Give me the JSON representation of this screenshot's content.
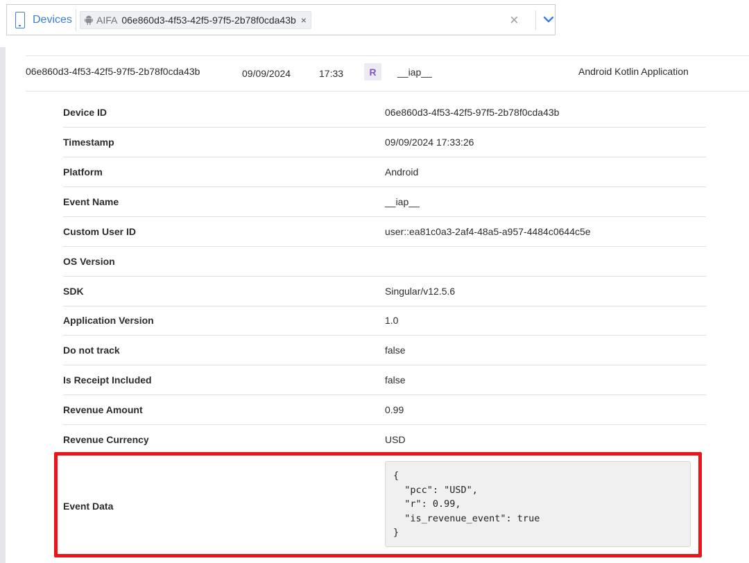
{
  "filter_bar": {
    "label": "Devices",
    "chip": {
      "type": "AIFA",
      "value": "06e860d3-4f53-42f5-97f5-2b78f0cda43b",
      "remove": "×"
    },
    "clear": "×"
  },
  "summary_row": {
    "device_id": "06e860d3-4f53-42f5-97f5-2b78f0cda43b",
    "date": "09/09/2024",
    "time": "17:33",
    "badge": "R",
    "event": "__iap__",
    "app": "Android Kotlin Application"
  },
  "details": [
    {
      "key": "Device ID",
      "value": "06e860d3-4f53-42f5-97f5-2b78f0cda43b"
    },
    {
      "key": "Timestamp",
      "value": "09/09/2024 17:33:26"
    },
    {
      "key": "Platform",
      "value": "Android"
    },
    {
      "key": "Event Name",
      "value": "__iap__"
    },
    {
      "key": "Custom User ID",
      "value": "user::ea81c0a3-2af4-48a5-a957-4484c0644c5e"
    },
    {
      "key": "OS Version",
      "value": ""
    },
    {
      "key": "SDK",
      "value": "Singular/v12.5.6"
    },
    {
      "key": "Application Version",
      "value": "1.0"
    },
    {
      "key": "Do not track",
      "value": "false"
    },
    {
      "key": "Is Receipt Included",
      "value": "false"
    },
    {
      "key": "Revenue Amount",
      "value": "0.99"
    },
    {
      "key": "Revenue Currency",
      "value": "USD"
    }
  ],
  "event_data": {
    "key": "Event Data",
    "json_text": "{\n  \"pcc\": \"USD\",\n  \"r\": 0.99,\n  \"is_revenue_event\": true\n}"
  },
  "colors": {
    "accent": "#3a7fd5",
    "highlight": "#e8161b",
    "badge_text": "#7c58b8"
  },
  "icons": {
    "device": "mobile-device-icon",
    "platform": "android-icon",
    "remove": "close-icon",
    "dropdown": "chevron-down-icon"
  }
}
